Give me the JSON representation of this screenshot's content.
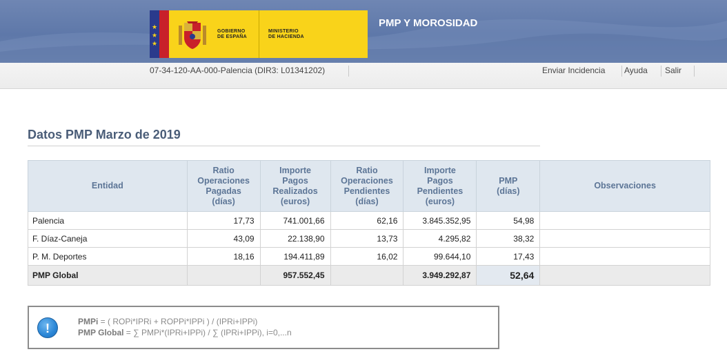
{
  "header": {
    "logo": {
      "gobierno_line1": "GOBIERNO",
      "gobierno_line2": "DE ESPAÑA",
      "ministerio_line1": "MINISTERIO",
      "ministerio_line2": "DE HACIENDA"
    },
    "app_title": "PMP Y MOROSIDAD",
    "colors": {
      "band": "#5e78a9",
      "logo_bg": "#f9d31a"
    }
  },
  "subbar": {
    "entity_code": "07-34-120-AA-000-Palencia (DIR3: L01341202)",
    "links": [
      "Enviar Incidencia",
      "Ayuda",
      "Salir"
    ]
  },
  "main": {
    "title": "Datos PMP Marzo de 2019",
    "table": {
      "headers": [
        [
          "Entidad"
        ],
        [
          "Ratio",
          "Operaciones",
          "Pagadas",
          "(días)"
        ],
        [
          "Importe",
          "Pagos",
          "Realizados",
          "(euros)"
        ],
        [
          "Ratio",
          "Operaciones",
          "Pendientes",
          "(días)"
        ],
        [
          "Importe",
          "Pagos",
          "Pendientes",
          "(euros)"
        ],
        [
          "PMP",
          "(días)"
        ],
        [
          "Observaciones"
        ]
      ],
      "rows": [
        [
          "Palencia",
          "17,73",
          "741.001,66",
          "62,16",
          "3.845.352,95",
          "54,98",
          ""
        ],
        [
          "F. Díaz-Caneja",
          "43,09",
          "22.138,90",
          "13,73",
          "4.295,82",
          "38,32",
          ""
        ],
        [
          "P. M. Deportes",
          "18,16",
          "194.411,89",
          "16,02",
          "99.644,10",
          "17,43",
          ""
        ]
      ],
      "global_row": [
        "PMP Global",
        "",
        "957.552,45",
        "",
        "3.949.292,87",
        "52,64",
        ""
      ]
    },
    "formula": {
      "icon": "info-icon",
      "line1_label": "PMPi",
      "line1_text": " = ( ROPi*IPRi + ROPPi*IPPi ) / (IPRi+IPPi)",
      "line2_label": "PMP Global",
      "line2_text": " = ∑ PMPi*(IPRi+IPPi) / ∑ (IPRi+IPPi), i=0,...n"
    }
  }
}
